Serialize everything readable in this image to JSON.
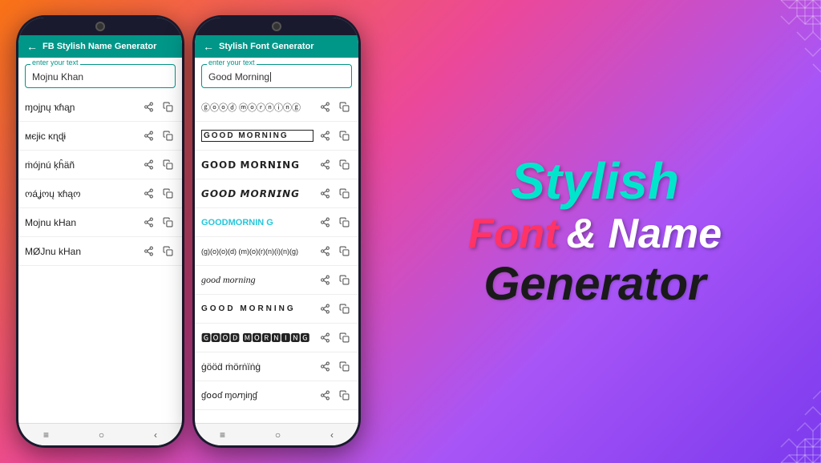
{
  "background": {
    "gradient": "orange to purple"
  },
  "phone1": {
    "header": {
      "back": "←",
      "title": "FB Stylish Name Generator"
    },
    "input": {
      "label": "enter your text",
      "value": "Mojnu Khan"
    },
    "results": [
      {
        "text": "ɱojɲų ҡɦąɲ",
        "style": "unicode1"
      },
      {
        "text": "мєjɨc ĸɳɖɨ",
        "style": "unicode2"
      },
      {
        "text": "ṁójnú ķĥäñ",
        "style": "unicode3"
      },
      {
        "text": "ოáʝოų ҡɦąო",
        "style": "unicode4"
      },
      {
        "text": "Mojnu kHan",
        "style": "normal"
      },
      {
        "text": "MØJnu kHan",
        "style": "unicode5"
      }
    ],
    "nav": [
      "≡",
      "○",
      "‹"
    ]
  },
  "phone2": {
    "header": {
      "back": "←",
      "title": "Stylish Font Generator"
    },
    "input": {
      "label": "enter your text",
      "value": "Good Morning",
      "cursor": true
    },
    "results": [
      {
        "text": "ⓖⓞⓞⓓ ⓜⓞⓡⓝⓘⓝⓖ",
        "style": "circled"
      },
      {
        "text": "GOOD MORNING",
        "style": "outlined-box"
      },
      {
        "text": "𝗚𝗢𝗢𝗗 𝗠𝗢𝗥𝗡𝗜𝗡𝗚",
        "style": "bold-black"
      },
      {
        "text": "𝙂𝙊𝙊𝘿 𝙈𝙊𝙍𝙉𝙄𝙉𝙂",
        "style": "bold-italic"
      },
      {
        "text": "GOODMORNIN G",
        "style": "teal"
      },
      {
        "text": "(g)(o)(o)(d) (m)(o)(r)(n)(i)(n)(g)",
        "style": "parentheses"
      },
      {
        "text": "good morning",
        "style": "serif-italic"
      },
      {
        "text": "GOOD MORNING",
        "style": "uppercase-spaced"
      },
      {
        "text": "🅶🅾🅾🅳 🅼🅾🆁🅽🅸🅽🅶",
        "style": "boxed"
      },
      {
        "text": "ġööḋ ṁörṅïṅġ",
        "style": "decorative"
      },
      {
        "text": "ɠ໐໐ɗ ɱo𝘳ŋiŋɠ",
        "style": "script"
      }
    ],
    "nav": [
      "≡",
      "○",
      "‹"
    ]
  },
  "headline": {
    "line1": "Stylish",
    "line2_font": "Font",
    "line2_amp": "& Name",
    "line3": "Generator"
  },
  "icons": {
    "share": "⬆",
    "copy": "⧉",
    "back": "←"
  }
}
